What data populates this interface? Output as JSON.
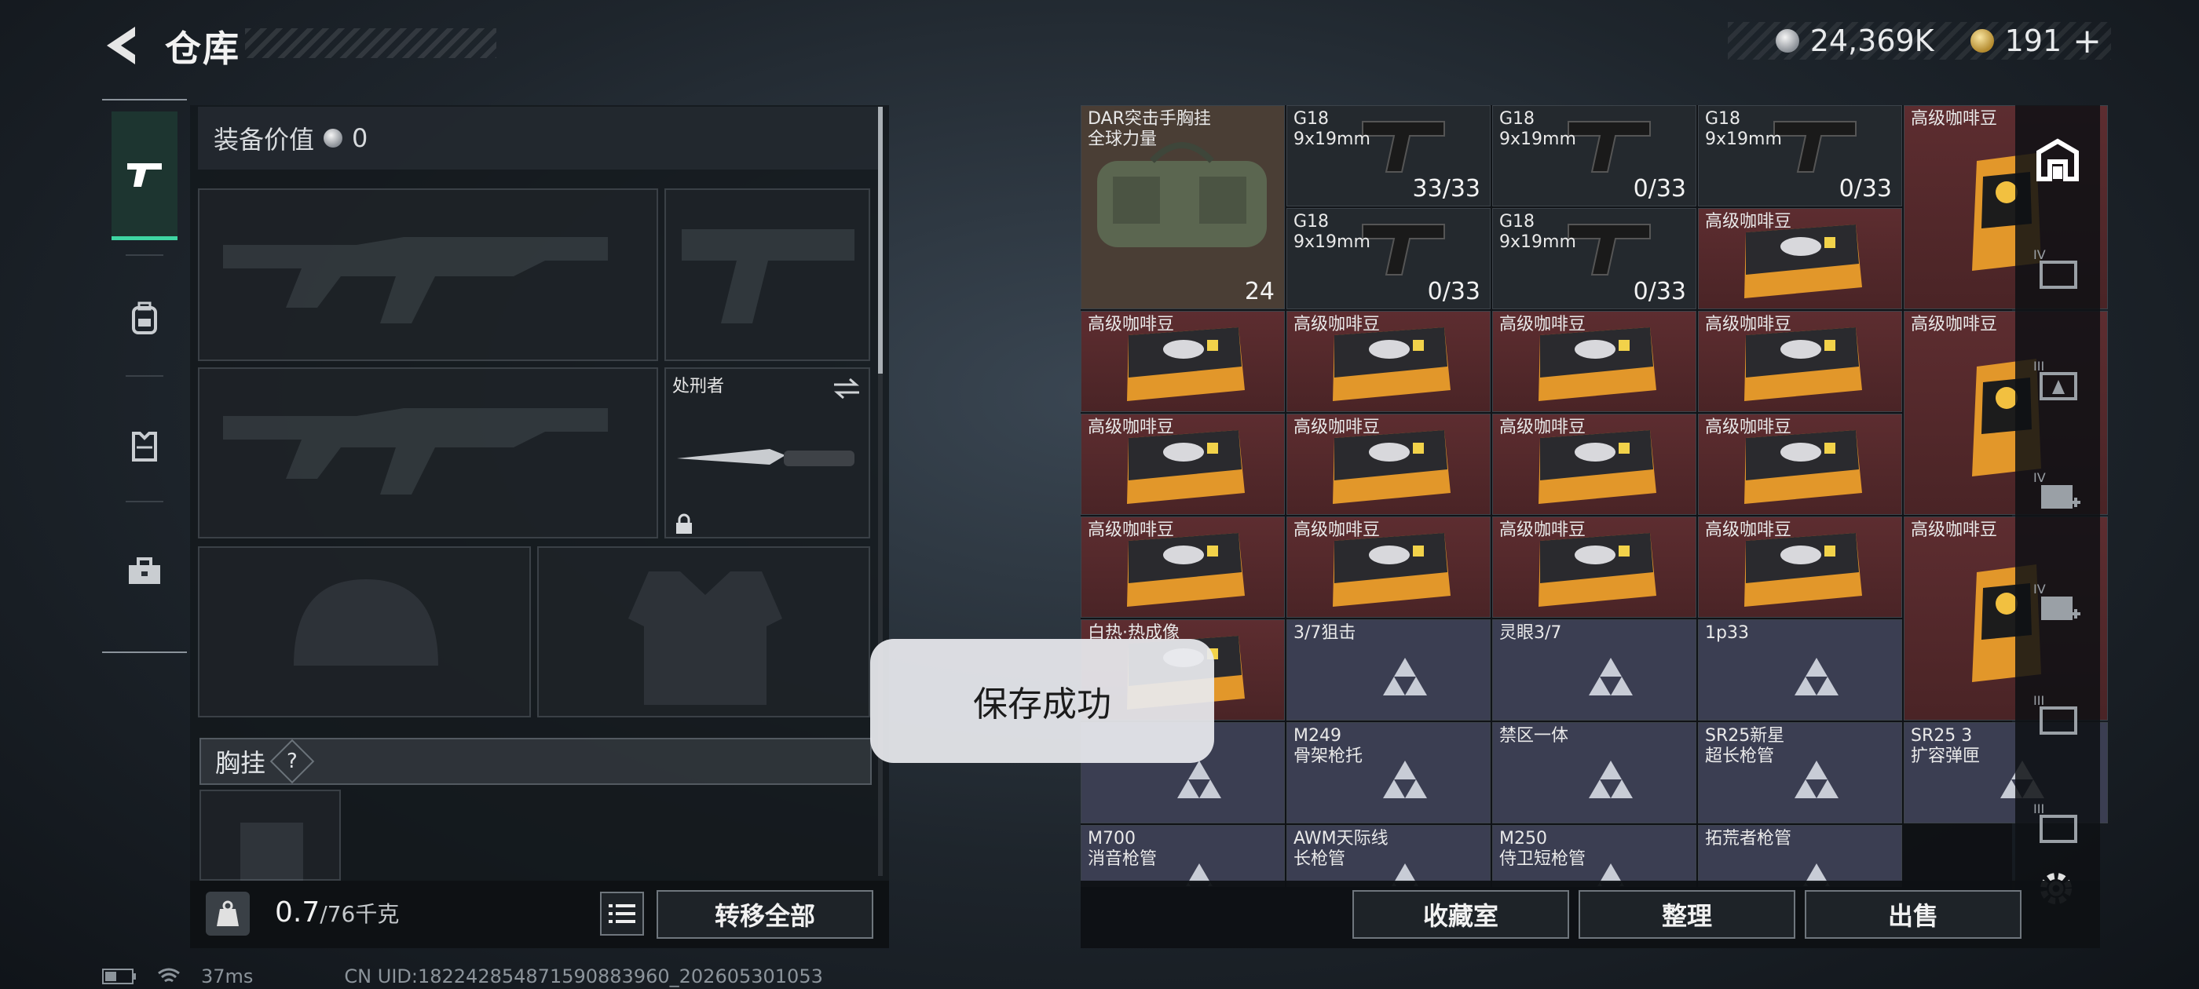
{
  "header": {
    "title": "仓库"
  },
  "currency": {
    "silver": "24,369K",
    "gold": "191",
    "gold_add": "+"
  },
  "equip": {
    "value_label": "装备价值",
    "value": "0",
    "melee_name": "处刑者",
    "vest_label": "胸挂",
    "vest_help": "?"
  },
  "weight": {
    "current": "0.7",
    "max": "/76千克"
  },
  "buttons": {
    "transfer_all": "转移全部",
    "collection": "收藏室",
    "organize": "整理",
    "sell": "出售"
  },
  "grid_items": [
    {
      "name": "DAR突击手胸挂\n全球力量",
      "qty": "24",
      "type": "brown"
    },
    {
      "name": "G18\n9x19mm",
      "qty": "33/33",
      "type": "dark"
    },
    {
      "name": "G18\n9x19mm",
      "qty": "0/33",
      "type": "dark"
    },
    {
      "name": "G18\n9x19mm",
      "qty": "0/33",
      "type": "dark"
    },
    {
      "name": "高级咖啡豆",
      "qty": "",
      "type": "red"
    },
    {
      "name": "G18\n9x19mm",
      "qty": "0/33",
      "type": "dark"
    },
    {
      "name": "G18\n9x19mm",
      "qty": "0/33",
      "type": "dark"
    },
    {
      "name": "高级咖啡豆",
      "qty": "",
      "type": "red"
    },
    {
      "name": "高级咖啡豆",
      "qty": "",
      "type": "red"
    },
    {
      "name": "高级咖啡豆",
      "qty": "",
      "type": "red"
    },
    {
      "name": "高级咖啡豆",
      "qty": "",
      "type": "red"
    },
    {
      "name": "高级咖啡豆",
      "qty": "",
      "type": "red"
    },
    {
      "name": "高级咖啡豆",
      "qty": "",
      "type": "red"
    },
    {
      "name": "高级咖啡豆",
      "qty": "",
      "type": "red"
    },
    {
      "name": "高级咖啡豆",
      "qty": "",
      "type": "red"
    },
    {
      "name": "高级咖啡豆",
      "qty": "",
      "type": "red"
    },
    {
      "name": "高级咖啡豆",
      "qty": "",
      "type": "red"
    },
    {
      "name": "高级咖啡豆",
      "qty": "",
      "type": "red"
    },
    {
      "name": "高级咖啡豆",
      "qty": "",
      "type": "red"
    },
    {
      "name": "高级咖啡豆",
      "qty": "",
      "type": "red"
    },
    {
      "name": "高级咖啡豆",
      "qty": "",
      "type": "red"
    },
    {
      "name": "高级咖啡豆",
      "qty": "",
      "type": "red"
    },
    {
      "name": "白热·热成像",
      "qty": "",
      "type": "red"
    },
    {
      "name": "3/7狙击",
      "qty": "",
      "type": "purple"
    },
    {
      "name": "灵眼3/7",
      "qty": "",
      "type": "purple"
    },
    {
      "name": "1p33",
      "qty": "",
      "type": "purple"
    },
    {
      "name": "",
      "qty": "",
      "type": "purple"
    },
    {
      "name": "M249\n骨架枪托",
      "qty": "",
      "type": "purple"
    },
    {
      "name": "禁区一体",
      "qty": "",
      "type": "purple"
    },
    {
      "name": "SR25新星\n超长枪管",
      "qty": "",
      "type": "purple"
    },
    {
      "name": "SR25 3\n扩容弹匣",
      "qty": "",
      "type": "purple"
    },
    {
      "name": "M700\n消音枪管",
      "qty": "",
      "type": "purple"
    },
    {
      "name": "AWM天际线\n长枪管",
      "qty": "",
      "type": "purple"
    },
    {
      "name": "M250\n侍卫短枪管",
      "qty": "",
      "type": "purple"
    },
    {
      "name": "拓荒者枪管",
      "qty": "",
      "type": "purple"
    }
  ],
  "toast": {
    "message": "保存成功"
  },
  "status": {
    "ping": "37ms",
    "uid": "CN UID:182242854871590883960_202605301053"
  },
  "colors": {
    "accent": "#3fd6a3",
    "red_item": "#5d2d30",
    "purple_item": "#3b3e52"
  }
}
